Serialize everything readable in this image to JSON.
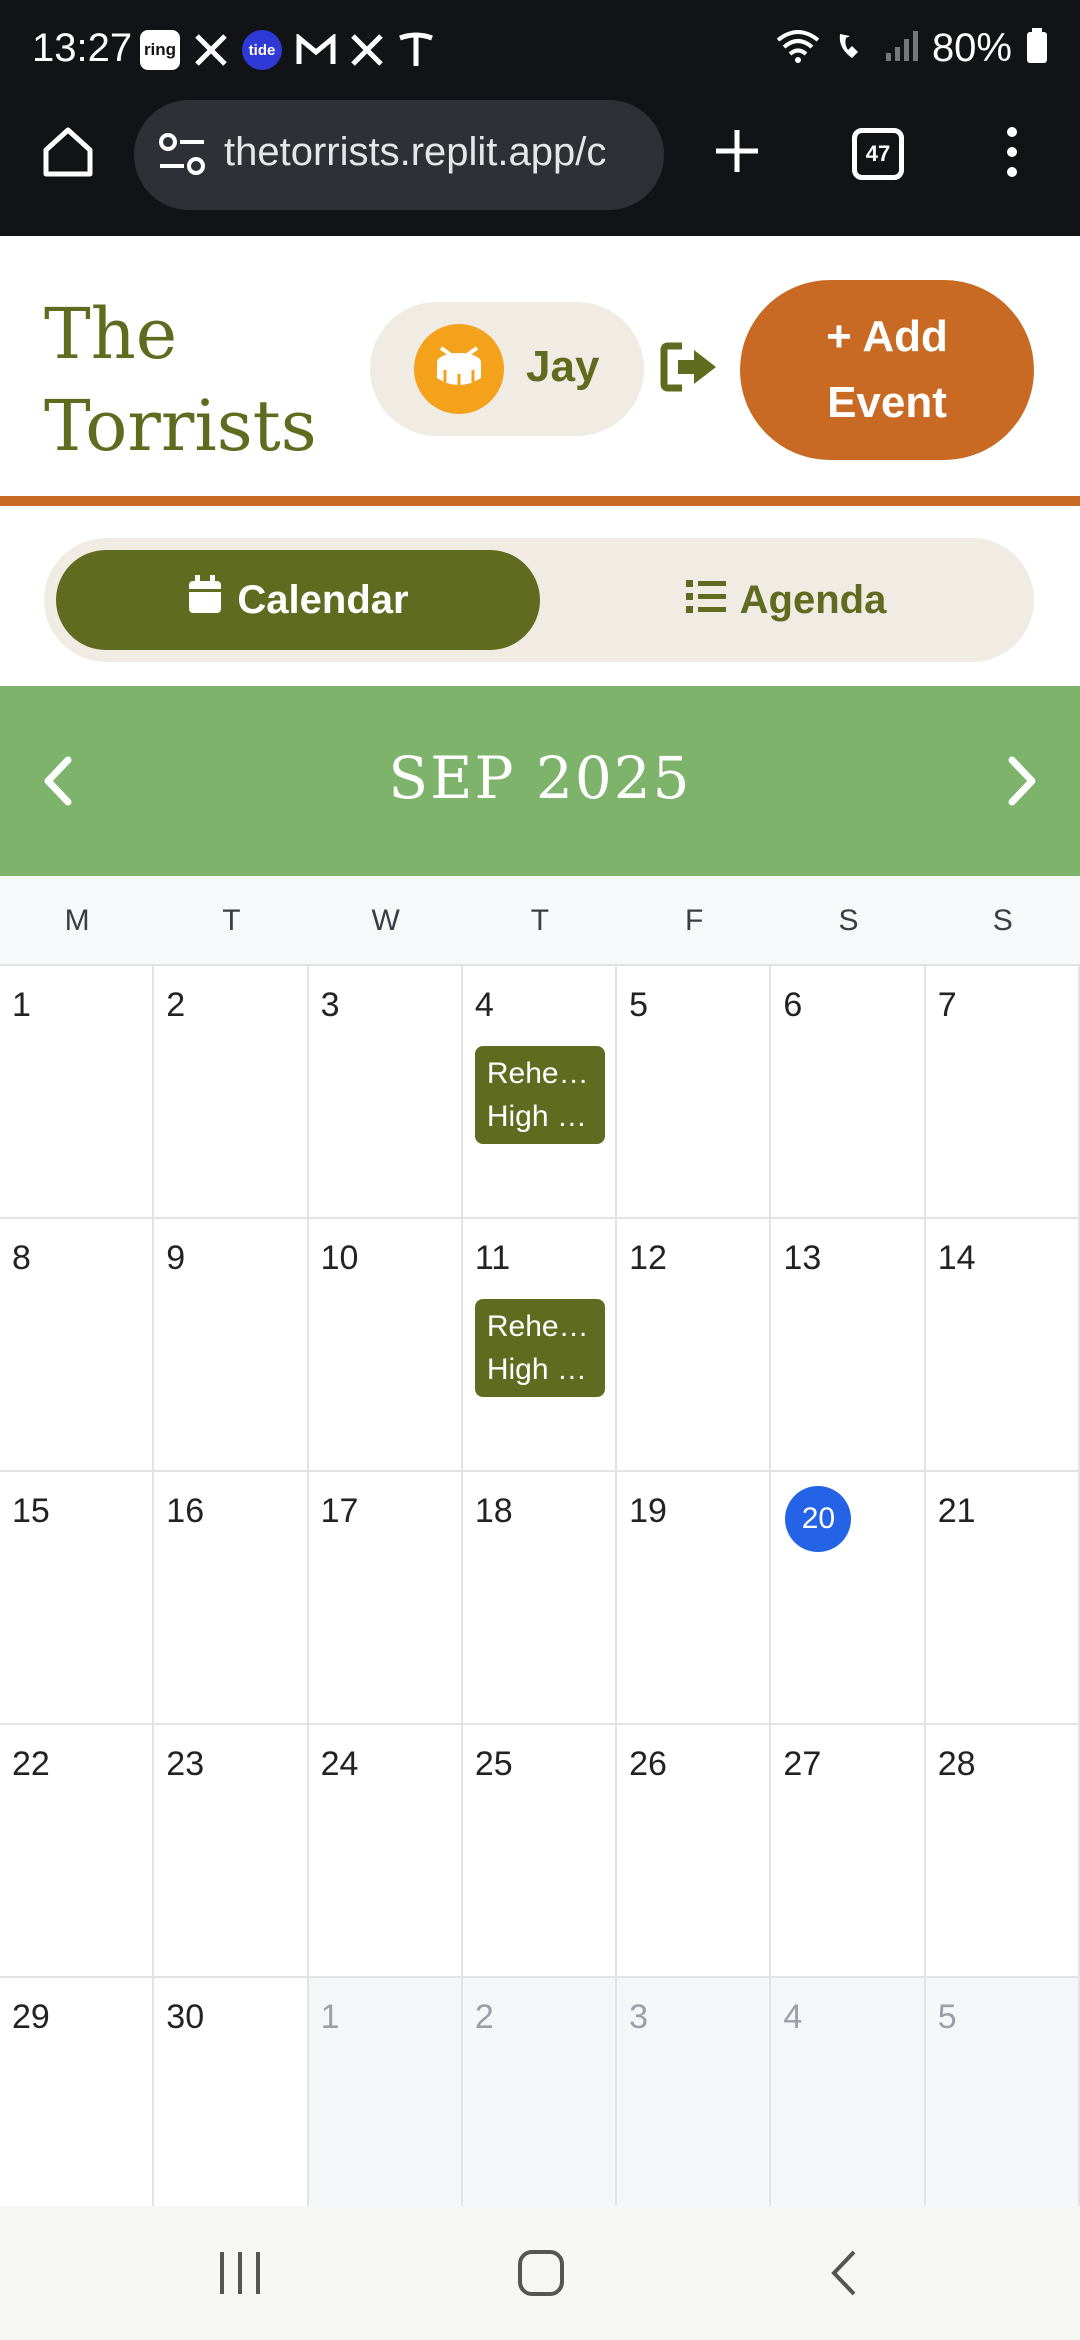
{
  "status_bar": {
    "time": "13:27",
    "apps": [
      "ring",
      "x-icon",
      "tide",
      "gmail-icon",
      "x-icon",
      "tesla-icon"
    ],
    "ring_label": "ring",
    "tide_label": "tide",
    "battery": "80%"
  },
  "browser": {
    "url": "thetorrists.replit.app/c",
    "tabs_count": "47"
  },
  "header": {
    "brand_line1": "The",
    "brand_line2": "Torrists",
    "user_name": "Jay",
    "add_event_line1": "+ Add",
    "add_event_line2": "Event"
  },
  "view_toggle": {
    "calendar_label": "Calendar",
    "agenda_label": "Agenda",
    "active": "calendar"
  },
  "calendar": {
    "month_title": "SEP 2025",
    "weekdays": [
      "M",
      "T",
      "W",
      "T",
      "F",
      "S",
      "S"
    ],
    "today": "20",
    "rows": [
      [
        "1",
        "2",
        "3",
        "4",
        "5",
        "6",
        "7"
      ],
      [
        "8",
        "9",
        "10",
        "11",
        "12",
        "13",
        "14"
      ],
      [
        "15",
        "16",
        "17",
        "18",
        "19",
        "20",
        "21"
      ],
      [
        "22",
        "23",
        "24",
        "25",
        "26",
        "27",
        "28"
      ],
      [
        "29",
        "30",
        "1",
        "2",
        "3",
        "4",
        "5"
      ]
    ],
    "events": {
      "sep4_line1": "Rehe…",
      "sep4_line2": "High …",
      "sep11_line1": "Rehe…",
      "sep11_line2": "High …"
    }
  },
  "colors": {
    "olive": "#5f6b1f",
    "orange": "#c86a23",
    "green_header": "#7db36b",
    "today_blue": "#2563e6"
  }
}
